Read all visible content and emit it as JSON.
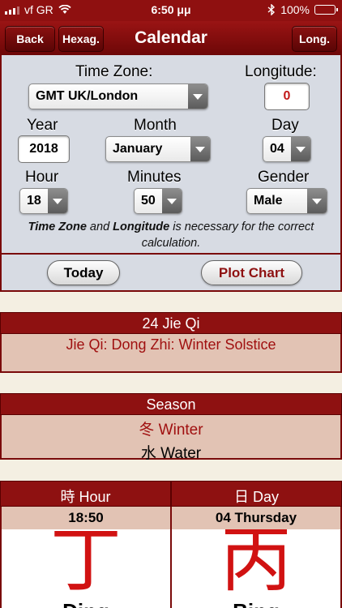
{
  "status_bar": {
    "carrier": "vf GR",
    "time": "6:50 μμ",
    "battery": "100%",
    "battery_level": 1.0
  },
  "nav": {
    "back_label": "Back",
    "hexag_label": "Hexag.",
    "title": "Calendar",
    "long_label": "Long."
  },
  "form": {
    "timezone_label": "Time Zone:",
    "timezone_value": "GMT UK/London",
    "longitude_label": "Longitude:",
    "longitude_value": "0",
    "year_label": "Year",
    "year_value": "2018",
    "month_label": "Month",
    "month_value": "January",
    "day_label": "Day",
    "day_value": "04",
    "hour_label": "Hour",
    "hour_value": "18",
    "minutes_label": "Minutes",
    "minutes_value": "50",
    "gender_label": "Gender",
    "gender_value": "Male",
    "note_part1": "Time Zone",
    "note_part2": " and ",
    "note_part3": "Longitude",
    "note_part4": " is necessary for the correct calculation."
  },
  "actions": {
    "today_label": "Today",
    "plot_label": "Plot Chart"
  },
  "jieqi": {
    "header": "24 Jie Qi",
    "value": "Jie Qi: Dong Zhi: Winter Solstice"
  },
  "season": {
    "header": "Season",
    "season_value": "冬 Winter",
    "element_value": "水 Water"
  },
  "hour_col": {
    "header": "時 Hour",
    "sub": "18:50",
    "stem_char": "丁",
    "stem_label": "Ding"
  },
  "day_col": {
    "header": "日 Day",
    "sub": "04 Thursday",
    "stem_char": "丙",
    "stem_label": "Bing"
  },
  "colors": {
    "header_red": "#8e1111",
    "stem_red": "#d11212",
    "panel_grey": "#d7dbe3",
    "section_beige": "#e2c3b4"
  }
}
